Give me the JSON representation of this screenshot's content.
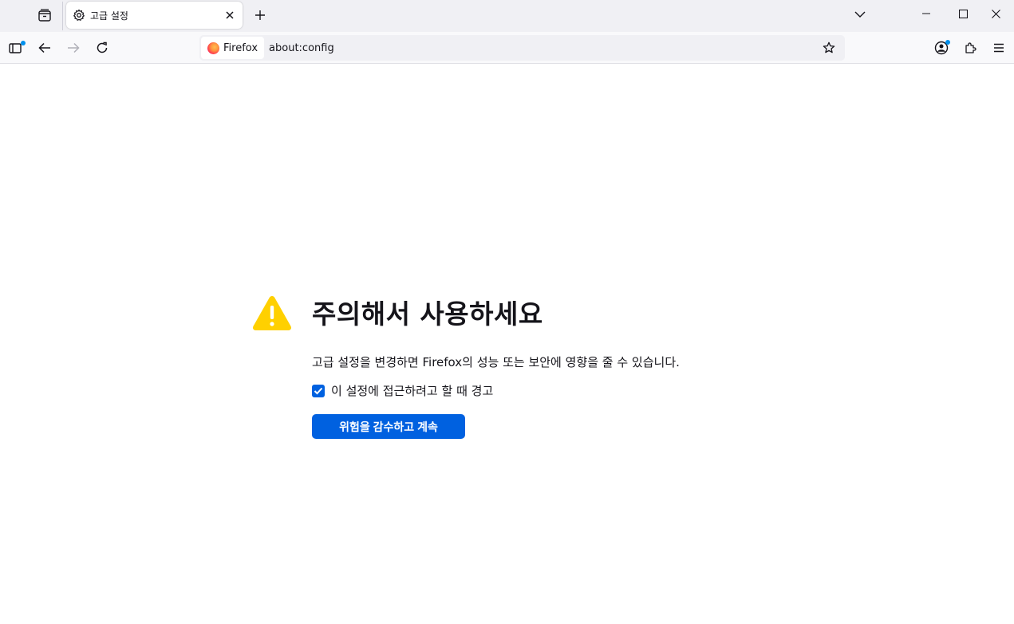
{
  "tabs": [
    {
      "title": "고급 설정",
      "icon": "gear-icon"
    }
  ],
  "toolbar": {
    "identity_label": "Firefox",
    "url": "about:config"
  },
  "warning": {
    "title": "주의해서 사용하세요",
    "description": "고급 설정을 변경하면 Firefox의 성능 또는 보안에 영향을 줄 수 있습니다.",
    "checkbox_label": "이 설정에 접근하려고 할 때 경고",
    "checkbox_checked": true,
    "accept_button": "위험을 감수하고 계속"
  },
  "colors": {
    "accent": "#0061e0",
    "warning": "#ffd000",
    "notification_dot": "#0090ed"
  }
}
